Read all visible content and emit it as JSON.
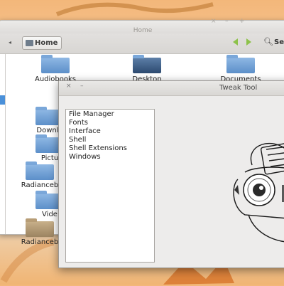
{
  "file_manager": {
    "title": "Home",
    "window_controls": [
      "×",
      "–",
      "+"
    ],
    "back_arrow": "◂",
    "breadcrumb": "Home",
    "search_label": "Se",
    "items": [
      {
        "label": "Audiobooks",
        "icon": "folder-icon"
      },
      {
        "label": "Desktop",
        "icon": "desktop-folder-icon"
      },
      {
        "label": "Documents",
        "icon": "folder-icon"
      },
      {
        "label": "Downlo",
        "icon": "download-folder-icon"
      },
      {
        "label": "Pictu",
        "icon": "pictures-folder-icon"
      },
      {
        "label": "Radianceb",
        "icon": "folder-icon"
      },
      {
        "label": "Vide",
        "icon": "videos-folder-icon"
      },
      {
        "label": "Radianceb",
        "icon": "zip-archive-icon"
      }
    ]
  },
  "tweak_tool": {
    "title": "Tweak Tool",
    "window_controls": [
      "×",
      "–"
    ],
    "categories": [
      "File Manager",
      "Fonts",
      "Interface",
      "Shell",
      "Shell Extensions",
      "Windows"
    ]
  },
  "colors": {
    "accent_selection": "#4a90d9",
    "nav_arrows": "#8dc24a",
    "folder_blue": "#5c8fc9"
  }
}
